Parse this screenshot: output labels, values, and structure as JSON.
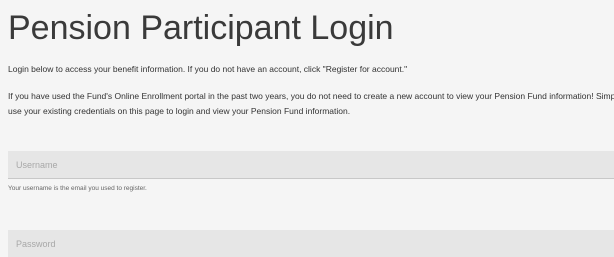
{
  "header": {
    "title": "Pension Participant Login"
  },
  "content": {
    "intro": "Login below to access your benefit information. If you do not have an account, click \"Register for account.\"",
    "note": "If you have used the Fund's Online Enrollment portal in the past two years, you do not need to create a new account to view your Pension Fund information! Simply use your existing credentials on this page to login and view your Pension Fund information."
  },
  "form": {
    "username": {
      "placeholder": "Username",
      "value": "",
      "help": "Your username is the email you used to register."
    },
    "password": {
      "placeholder": "Password",
      "value": ""
    }
  }
}
